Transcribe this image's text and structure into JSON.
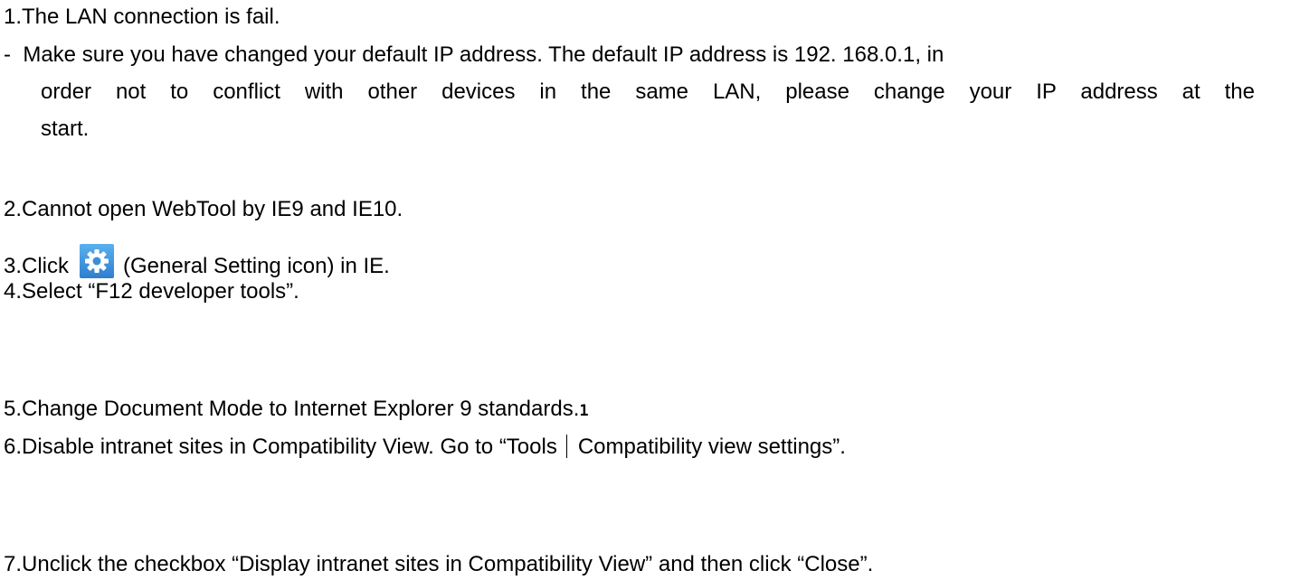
{
  "items": {
    "item1": {
      "num": "1.",
      "text": "The LAN connection is fail."
    },
    "note": {
      "dash": "-",
      "line1": "Make sure you have changed your default IP address. The default IP address is 192. 168.0.1, in",
      "line2": "order not to conflict with other devices in the same LAN, please change your IP address at the",
      "line3": "start."
    },
    "item2": {
      "num": "2.",
      "text": "Cannot open WebTool by IE9 and IE10."
    },
    "item3": {
      "num": "3.",
      "before": "Click",
      "after": "(General Setting icon) in IE.",
      "icon": "gear-icon",
      "icon_color": "#3b8ed8"
    },
    "item4": {
      "num": "4.",
      "text": "Select “F12 developer tools”."
    },
    "item5": {
      "num": "5.",
      "text": "Change Document Mode to Internet Explorer 9 standards.",
      "footnote": "1"
    },
    "item6": {
      "num": "6.",
      "before": "Disable intranet sites in Compatibility View. Go to “Tools",
      "after": "Compatibility view settings”."
    },
    "item7": {
      "num": "7.",
      "text": "Unclick the checkbox “Display intranet sites in Compatibility View” and then click “Close”."
    }
  }
}
